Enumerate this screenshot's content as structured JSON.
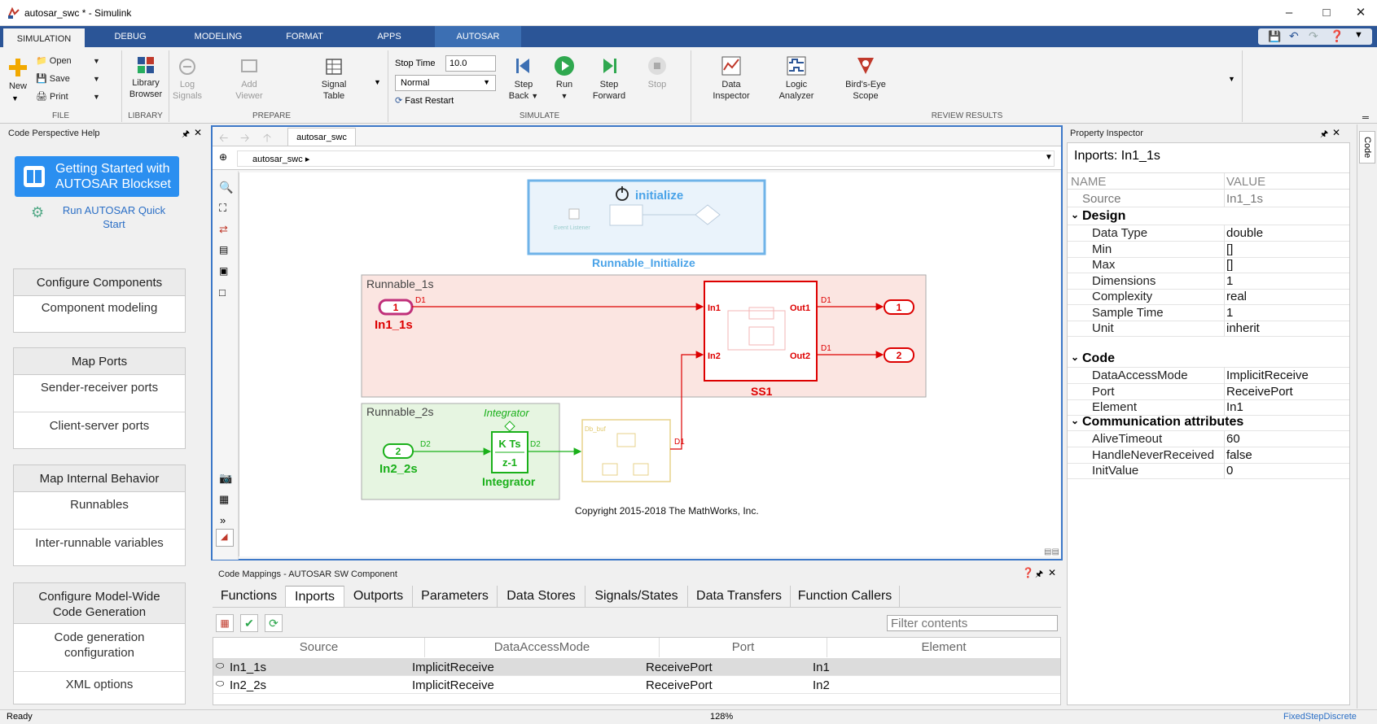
{
  "window": {
    "title": "autosar_swc * - Simulink"
  },
  "ribbon_tabs": [
    "SIMULATION",
    "DEBUG",
    "MODELING",
    "FORMAT",
    "APPS",
    "AUTOSAR"
  ],
  "file": {
    "new": "New",
    "open": "Open",
    "save": "Save",
    "print": "Print",
    "label": "FILE"
  },
  "library": {
    "browser_l1": "Library",
    "browser_l2": "Browser",
    "label": "LIBRARY"
  },
  "prepare": {
    "log_l1": "Log",
    "log_l2": "Signals",
    "add_l1": "Add",
    "add_l2": "Viewer",
    "sig_l1": "Signal",
    "sig_l2": "Table",
    "label": "PREPARE"
  },
  "simulate": {
    "stop_time_label": "Stop Time",
    "stop_time_value": "10.0",
    "mode": "Normal",
    "fast_restart": "Fast Restart",
    "step_back_l1": "Step",
    "step_back_l2": "Back",
    "run": "Run",
    "step_fwd_l1": "Step",
    "step_fwd_l2": "Forward",
    "stop": "Stop",
    "label": "SIMULATE"
  },
  "review": {
    "di_l1": "Data",
    "di_l2": "Inspector",
    "la_l1": "Logic",
    "la_l2": "Analyzer",
    "be_l1": "Bird's-Eye",
    "be_l2": "Scope",
    "label": "REVIEW RESULTS"
  },
  "help_panel": {
    "title": "Code Perspective Help",
    "getting_started_l1": "Getting Started with",
    "getting_started_l2": "AUTOSAR Blockset",
    "quickstart_l1": "Run AUTOSAR Quick",
    "quickstart_l2": "Start",
    "sections": [
      {
        "header": "Configure Components",
        "items": [
          "Component modeling"
        ]
      },
      {
        "header": "Map Ports",
        "items": [
          "Sender-receiver ports",
          "Client-server ports"
        ]
      },
      {
        "header": "Map Internal Behavior",
        "items": [
          "Runnables",
          "Inter-runnable variables"
        ]
      },
      {
        "header_l1": "Configure Model-Wide",
        "header_l2": "Code Generation",
        "items_l1": "Code generation",
        "items_l2": "configuration",
        "item3": "XML options"
      }
    ]
  },
  "editor": {
    "tab": "autosar_swc",
    "breadcrumb": "autosar_swc",
    "copyright": "Copyright 2015-2018 The MathWorks, Inc."
  },
  "diagram": {
    "initialize_title": "initialize",
    "initialize_event": "Event Listener",
    "initialize_block": "Runnable_Initialize",
    "runnable1": "Runnable_1s",
    "runnable2": "Runnable_2s",
    "in1_num": "1",
    "in1_label": "In1_1s",
    "d1a": "D1",
    "ss1_in1": "In1",
    "ss1_in2": "In2",
    "ss1_out1": "Out1",
    "ss1_out2": "Out2",
    "ss1_label": "SS1",
    "out1_d": "D1",
    "out2_d": "D1",
    "out1_num": "1",
    "out2_num": "2",
    "in2_num": "2",
    "in2_label": "In2_2s",
    "d2a": "D2",
    "d2b": "D2",
    "integ_top": "Integrator",
    "integ_num": "K Ts",
    "integ_den": "z-1",
    "integ_label": "Integrator",
    "dbbuf": "Db_buf",
    "d1c": "D1"
  },
  "property_inspector": {
    "title": "Property Inspector",
    "subtitle": "Inports: In1_1s",
    "col_name": "NAME",
    "col_value": "VALUE",
    "source_k": "Source",
    "source_v": "In1_1s",
    "design": "Design",
    "design_rows": [
      {
        "k": "Data Type",
        "v": "double"
      },
      {
        "k": "Min",
        "v": "[]"
      },
      {
        "k": "Max",
        "v": "[]"
      },
      {
        "k": "Dimensions",
        "v": "1"
      },
      {
        "k": "Complexity",
        "v": "real"
      },
      {
        "k": "Sample Time",
        "v": "1"
      },
      {
        "k": "Unit",
        "v": "inherit"
      }
    ],
    "code": "Code",
    "code_rows": [
      {
        "k": "DataAccessMode",
        "v": "ImplicitReceive"
      },
      {
        "k": "Port",
        "v": "ReceivePort"
      },
      {
        "k": "Element",
        "v": "In1"
      }
    ],
    "comm": "Communication attributes",
    "comm_rows": [
      {
        "k": "AliveTimeout",
        "v": "60"
      },
      {
        "k": "HandleNeverReceived",
        "v": "false"
      },
      {
        "k": "InitValue",
        "v": "0"
      }
    ],
    "side_tab": "Code"
  },
  "code_mappings": {
    "title": "Code Mappings - AUTOSAR SW Component",
    "tabs": [
      "Functions",
      "Inports",
      "Outports",
      "Parameters",
      "Data Stores",
      "Signals/States",
      "Data Transfers",
      "Function Callers"
    ],
    "filter_placeholder": "Filter contents",
    "columns": [
      "Source",
      "DataAccessMode",
      "Port",
      "Element"
    ],
    "rows": [
      [
        "In1_1s",
        "ImplicitReceive",
        "ReceivePort",
        "In1"
      ],
      [
        "In2_2s",
        "ImplicitReceive",
        "ReceivePort",
        "In2"
      ]
    ]
  },
  "status": {
    "left": "Ready",
    "zoom": "128%",
    "solver": "FixedStepDiscrete"
  }
}
